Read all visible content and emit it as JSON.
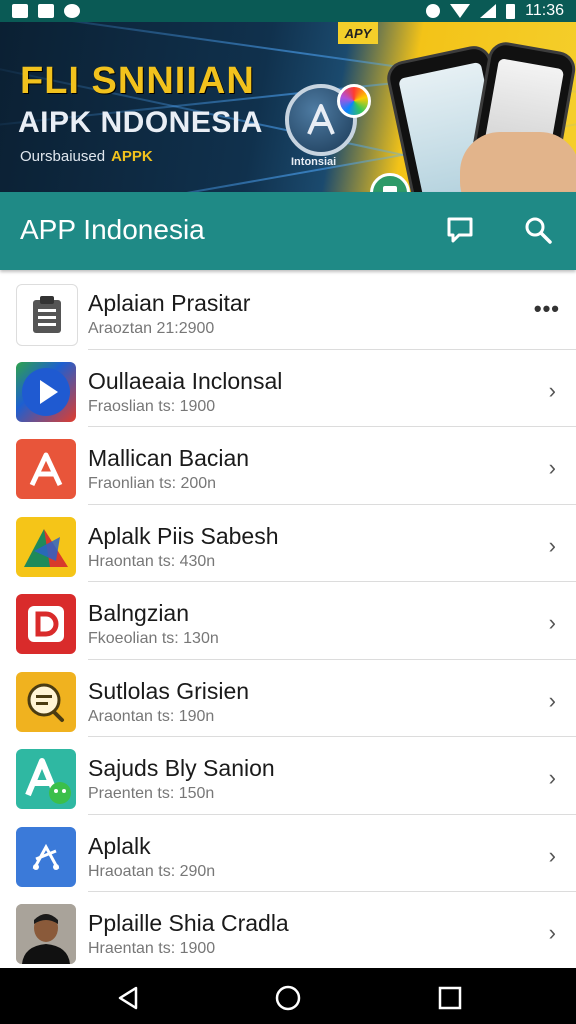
{
  "status_bar": {
    "time": "11:36"
  },
  "banner": {
    "tag": "APY",
    "title_line1": "FLI SNNIIAN",
    "title_line2": "AIPK NDONESIA",
    "subtitle": "Oursbaiused",
    "subtitle_accent": "APPK",
    "circle_label": "Intonsiai"
  },
  "appbar": {
    "title": "APP Indonesia"
  },
  "apps": [
    {
      "title": "Aplaian Prasitar",
      "subtitle": "Araoztan 21:2900"
    },
    {
      "title": "Oullaeaia Inclonsal",
      "subtitle": "Fraoslian ts: 1900"
    },
    {
      "title": "Mallican Bacian",
      "subtitle": "Fraonlian ts: 200n"
    },
    {
      "title": "Aplalk Piis Sabesh",
      "subtitle": "Hraontan ts: 430n"
    },
    {
      "title": "Balngzian",
      "subtitle": "Fkoeolian ts: 130n"
    },
    {
      "title": "Sutlolas Grisien",
      "subtitle": "Araontan ts: 190n"
    },
    {
      "title": "Sajuds Bly Sanion",
      "subtitle": "Praenten ts: 150n"
    },
    {
      "title": "Aplalk",
      "subtitle": "Hraoatan ts: 290n"
    },
    {
      "title": "Pplaille Shia Cradla",
      "subtitle": "Hraentan ts: 1900"
    }
  ]
}
